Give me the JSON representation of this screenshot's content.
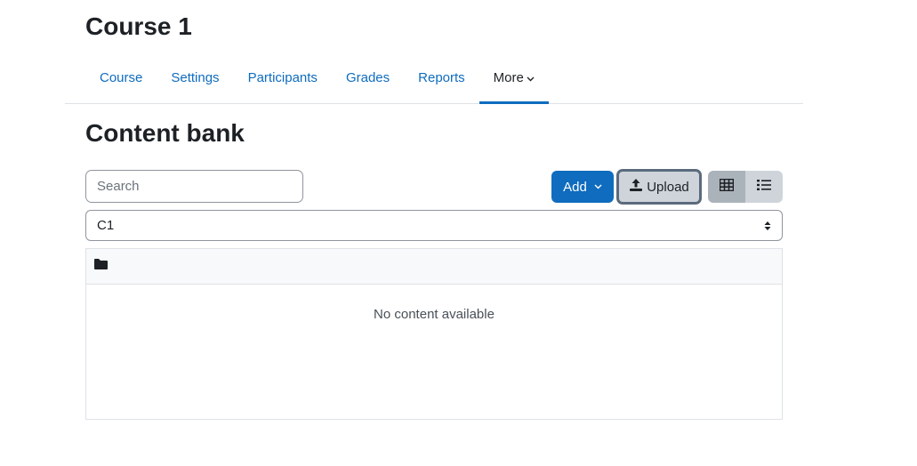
{
  "course": {
    "title": "Course 1"
  },
  "secondary_nav": {
    "items": [
      {
        "label": "Course"
      },
      {
        "label": "Settings"
      },
      {
        "label": "Participants"
      },
      {
        "label": "Grades"
      },
      {
        "label": "Reports"
      },
      {
        "label": "More"
      }
    ],
    "active": "More"
  },
  "page": {
    "heading": "Content bank"
  },
  "search": {
    "placeholder": "Search",
    "value": ""
  },
  "toolbar": {
    "add_label": "Add",
    "upload_label": "Upload",
    "grid_view_icon": "grid-icon",
    "list_view_icon": "list-icon"
  },
  "context_select": {
    "selected": "C1"
  },
  "content_bank": {
    "folder_icon": "folder-icon",
    "empty_message": "No content available"
  },
  "colors": {
    "primary": "#0f6cbf",
    "secondary": "#ced4da",
    "text": "#1d2125"
  }
}
